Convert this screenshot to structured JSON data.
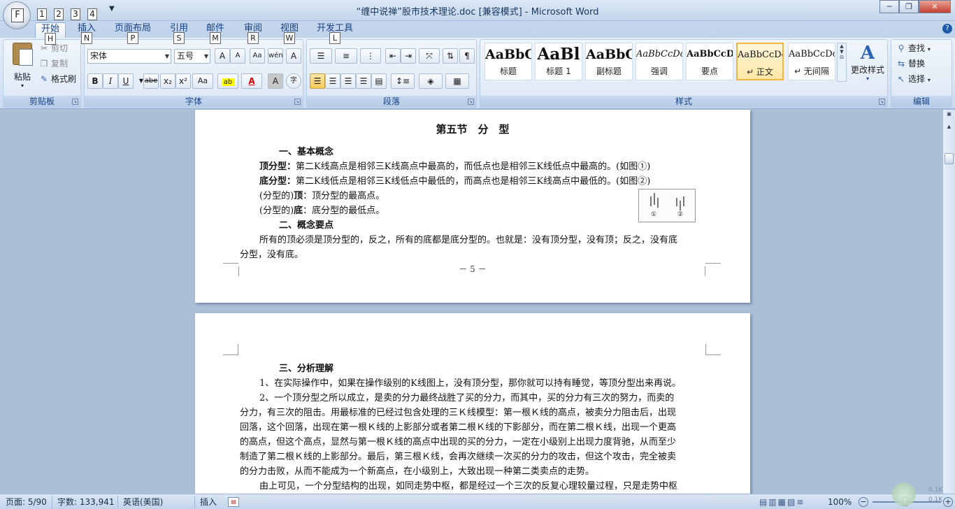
{
  "window": {
    "title": "“缠中说禅”股市技术理论.doc [兼容模式] - Microsoft Word",
    "minimize_glyph": "─",
    "restore_glyph": "❐",
    "close_glyph": "✕"
  },
  "office_button": {
    "keytip": "F"
  },
  "quick_access": [
    {
      "name": "save-icon",
      "keytip": "1"
    },
    {
      "name": "undo-icon",
      "keytip": "2"
    },
    {
      "name": "redo-icon",
      "keytip": "3"
    },
    {
      "name": "print-preview-icon",
      "keytip": "4"
    }
  ],
  "tabs": [
    {
      "label": "开始",
      "keytip": "H",
      "active": true
    },
    {
      "label": "插入",
      "keytip": "N"
    },
    {
      "label": "页面布局",
      "keytip": "P"
    },
    {
      "label": "引用",
      "keytip": "S"
    },
    {
      "label": "邮件",
      "keytip": "M"
    },
    {
      "label": "审阅",
      "keytip": "R"
    },
    {
      "label": "视图",
      "keytip": "W"
    },
    {
      "label": "开发工具",
      "keytip": "L"
    }
  ],
  "ribbon": {
    "clipboard": {
      "label": "剪贴板",
      "paste": "粘贴",
      "cut": "剪切",
      "copy": "复制",
      "format_painter": "格式刷"
    },
    "font": {
      "label": "字体",
      "font_name": "宋体",
      "font_size": "五号",
      "grow": "A",
      "shrink": "A",
      "clear": "Aa",
      "phonetic": "wén",
      "border_char": "A",
      "bold": "B",
      "italic": "I",
      "underline": "U",
      "strike": "abe",
      "sub": "x₂",
      "sup": "x²",
      "change_case": "Aa",
      "shading_char": "A",
      "enclose": "字"
    },
    "paragraph": {
      "label": "段落"
    },
    "styles": {
      "label": "样式",
      "change_styles": "更改样式",
      "items": [
        {
          "sample": "AaBbC",
          "name": "标题"
        },
        {
          "sample": "AaBl",
          "name": "标题 1"
        },
        {
          "sample": "AaBbC",
          "name": "副标题"
        },
        {
          "sample": "AaBbCcDc",
          "name": "强调"
        },
        {
          "sample": "AaBbCcD",
          "name": "要点"
        },
        {
          "sample": "AaBbCcDc",
          "name": "↵ 正文",
          "selected": true
        },
        {
          "sample": "AaBbCcDc",
          "name": "↵ 无间隔"
        }
      ]
    },
    "editing": {
      "label": "编辑",
      "find": "查找",
      "replace": "替换",
      "select": "选择"
    }
  },
  "page1": {
    "heading": "第五节　分　型",
    "sec1": "一、基本概念",
    "top_term": "顶分型：",
    "top_def": "第二K线高点是相邻三K线高点中最高的，而低点也是相邻三K线低点中最高的。(如图①)",
    "bottom_term": "底分型：",
    "bottom_def": "第二K线低点是相邻三K线低点中最低的，而高点也是相邻三K线高点中最低的。(如图②)",
    "peak_prefix": "(分型的)",
    "peak_term": "顶",
    "peak_def": "：顶分型的最高点。",
    "trough_prefix": "(分型的)",
    "trough_term": "底",
    "trough_def": "：底分型的最低点。",
    "sec2": "二、概念要点",
    "para_line1": "所有的顶必须是顶分型的，反之，所有的底都是底分型的。也就是：没有顶分型，没有顶；反之，没有底",
    "para_line2": "分型，没有底。",
    "page_number": "－ 5 －",
    "figure_label1": "①",
    "figure_label2": "②"
  },
  "page2": {
    "sec3": "三、分析理解",
    "lines": [
      "1、在实际操作中，如果在操作级别的K线图上，没有顶分型，那你就可以持有睡觉，等顶分型出来再说。",
      "2、一个顶分型之所以成立，是卖的分力最终战胜了买的分力，而其中，买的分力有三次的努力，而卖的",
      "分力，有三次的阻击。用最标准的已经过包含处理的三Ｋ线模型：第一根Ｋ线的高点，被卖分力阻击后，出现",
      "回落，这个回落，出现在第一根Ｋ线的上影部分或者第二根Ｋ线的下影部分，而在第二根Ｋ线，出现一个更高",
      "的高点，但这个高点，显然与第一根Ｋ线的高点中出现的买的分力，一定在小级别上出现力度背驰，从而至少",
      "制造了第二根Ｋ线的上影部分。最后，第三根Ｋ线，会再次继续一次买的分力的攻击，但这个攻击，完全被卖",
      "的分力击败，从而不能成为一个新高点，在小级别上，大致出现一种第二类卖点的走势。",
      "由上可见，一个分型结构的出现，如同走势中枢，都是经过一个三次的反复心理较量过程，只是走势中枢"
    ]
  },
  "statusbar": {
    "page": "页面: 5/90",
    "words": "字数: 133,941",
    "language": "英语(美国)",
    "mode": "插入",
    "zoom": "100%",
    "net_up": "0.1K",
    "net_down": "0.1K"
  }
}
